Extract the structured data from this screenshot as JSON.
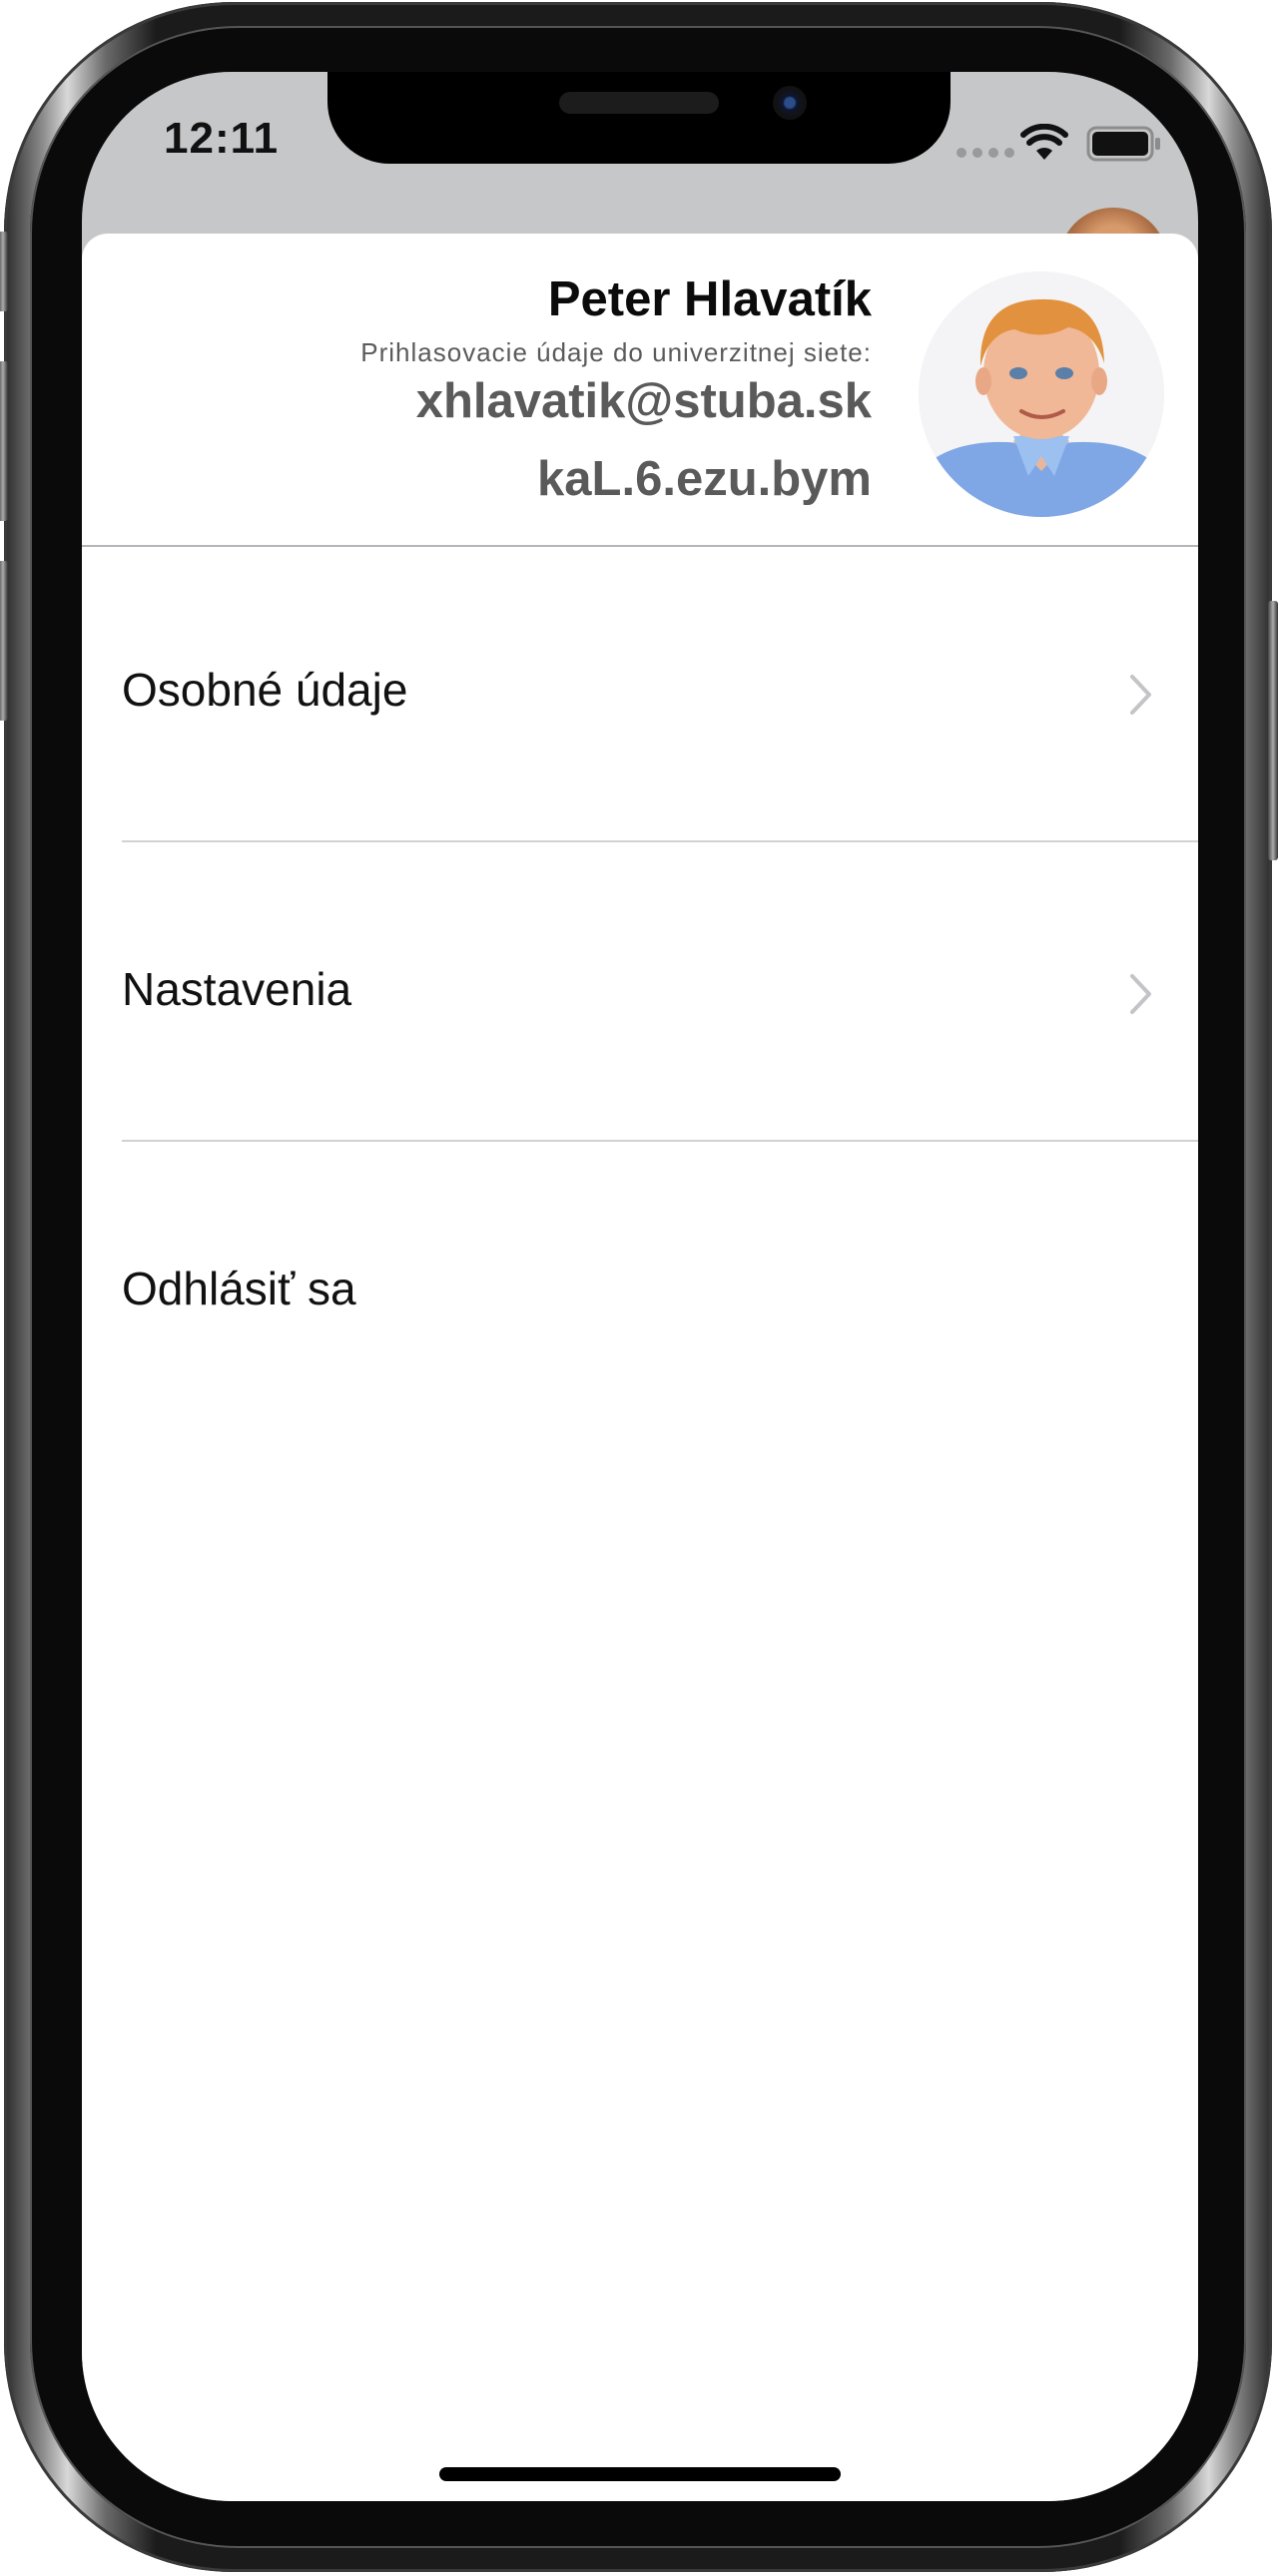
{
  "status_bar": {
    "time": "12:11"
  },
  "profile": {
    "name": "Peter Hlavatík",
    "credentials_label": "Prihlasovacie údaje do univerzitnej siete:",
    "login": "xhlavatik@stuba.sk",
    "password": "kaL.6.ezu.bym",
    "avatar_icon": "profile-photo"
  },
  "menu": {
    "items": [
      {
        "label": "Osobné údaje",
        "icon": "chevron-right-icon"
      },
      {
        "label": "Nastavenia",
        "icon": "chevron-right-icon"
      },
      {
        "label": "Odhlásiť sa"
      }
    ]
  },
  "colors": {
    "sheet_background": "#ffffff",
    "background_dim": "#c6c7c9",
    "secondary_text": "#5a5a5a",
    "chevron": "#c4c4c8"
  }
}
